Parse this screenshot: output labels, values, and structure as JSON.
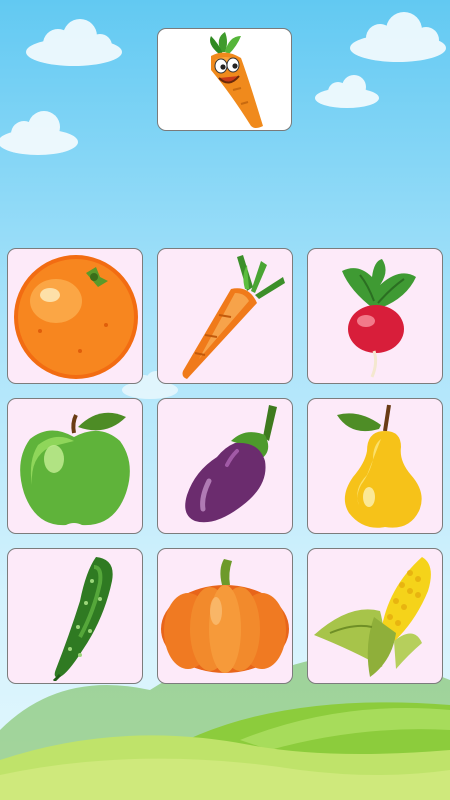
{
  "game": {
    "type": "matching",
    "target": {
      "item": "carrot",
      "icon": "cartoon-carrot-face-icon"
    }
  },
  "grid": {
    "rows": 3,
    "columns": 3,
    "tiles": [
      {
        "item": "orange",
        "icon": "orange-icon"
      },
      {
        "item": "carrot",
        "icon": "carrot-icon"
      },
      {
        "item": "radish",
        "icon": "radish-icon"
      },
      {
        "item": "apple",
        "icon": "green-apple-icon"
      },
      {
        "item": "eggplant",
        "icon": "eggplant-icon"
      },
      {
        "item": "pear",
        "icon": "pear-icon"
      },
      {
        "item": "cucumber",
        "icon": "cucumber-icon"
      },
      {
        "item": "pumpkin",
        "icon": "pumpkin-icon"
      },
      {
        "item": "corn",
        "icon": "corn-icon"
      }
    ]
  },
  "colors": {
    "sky_top": "#62c9f2",
    "sky_bottom": "#e3f7fd",
    "tile_background": "#fdeaf9",
    "tile_border": "#7c7c7c",
    "target_background": "#ffffff",
    "hill_green": "#8ccc3c"
  }
}
